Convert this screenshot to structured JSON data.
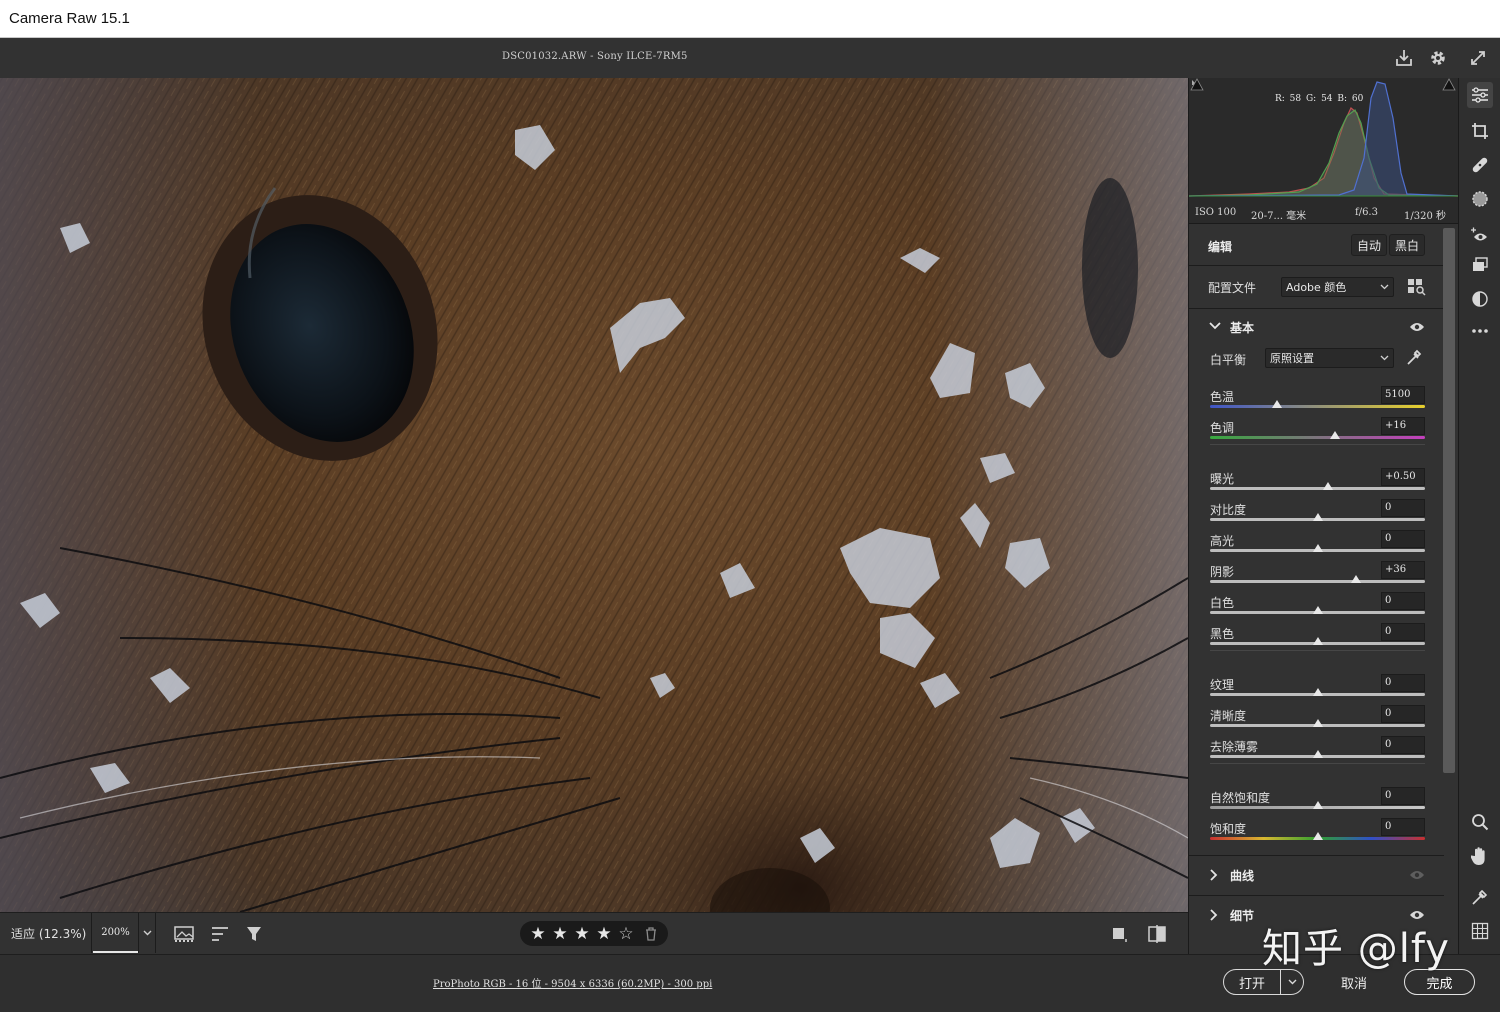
{
  "window": {
    "title": "Camera Raw 15.1"
  },
  "topbar": {
    "file_info": "DSC01032.ARW -  Sony ILCE-7RM5"
  },
  "histogram": {
    "rgb_readout": "R: 58   G: 54   B: 60",
    "exif": {
      "iso": "ISO 100",
      "lens": "20-7... 毫米",
      "aperture": "f/6.3",
      "shutter": "1/320 秒"
    }
  },
  "edit": {
    "label": "编辑",
    "auto_label": "自动",
    "bw_label": "黑白",
    "profile_label": "配置文件",
    "profile_value": "Adobe 颜色"
  },
  "basic": {
    "label": "基本",
    "wb_label": "白平衡",
    "wb_value": "原照设置",
    "groups": [
      [
        {
          "label": "色温",
          "value": "5100",
          "position": 0.31
        },
        {
          "label": "色调",
          "value": "+16",
          "position": 0.58
        }
      ],
      [
        {
          "label": "曝光",
          "value": "+0.50",
          "position": 0.55
        },
        {
          "label": "对比度",
          "value": "0",
          "position": 0.5
        },
        {
          "label": "高光",
          "value": "0",
          "position": 0.5
        },
        {
          "label": "阴影",
          "value": "+36",
          "position": 0.68
        },
        {
          "label": "白色",
          "value": "0",
          "position": 0.5
        },
        {
          "label": "黑色",
          "value": "0",
          "position": 0.5
        }
      ],
      [
        {
          "label": "纹理",
          "value": "0",
          "position": 0.5
        },
        {
          "label": "清晰度",
          "value": "0",
          "position": 0.5
        },
        {
          "label": "去除薄雾",
          "value": "0",
          "position": 0.5
        }
      ],
      [
        {
          "label": "自然饱和度",
          "value": "0",
          "position": 0.5
        },
        {
          "label": "饱和度",
          "value": "0",
          "position": 0.5
        }
      ]
    ]
  },
  "sections": {
    "curve": "曲线",
    "detail": "细节"
  },
  "viewbar": {
    "fit": "适应 (12.3%)",
    "zoom": "200%"
  },
  "rating": {
    "stars": 4,
    "max": 5
  },
  "footer": {
    "workflow": "ProPhoto RGB - 16 位 - 9504 x 6336 (60.2MP) - 300 ppi",
    "open": "打开",
    "cancel": "取消",
    "done": "完成"
  },
  "watermark": "知乎 @lfy",
  "colors": {
    "panel": "#323232",
    "accent": "#e8e8e8",
    "temp_gradient": [
      "#3f55c8",
      "#e7d02c"
    ],
    "tint_gradient": [
      "#37a83e",
      "#c43fbd"
    ],
    "sat_gradient": [
      "#c83030",
      "#d8b830",
      "#30a030",
      "#3050c8",
      "#c83030"
    ]
  }
}
